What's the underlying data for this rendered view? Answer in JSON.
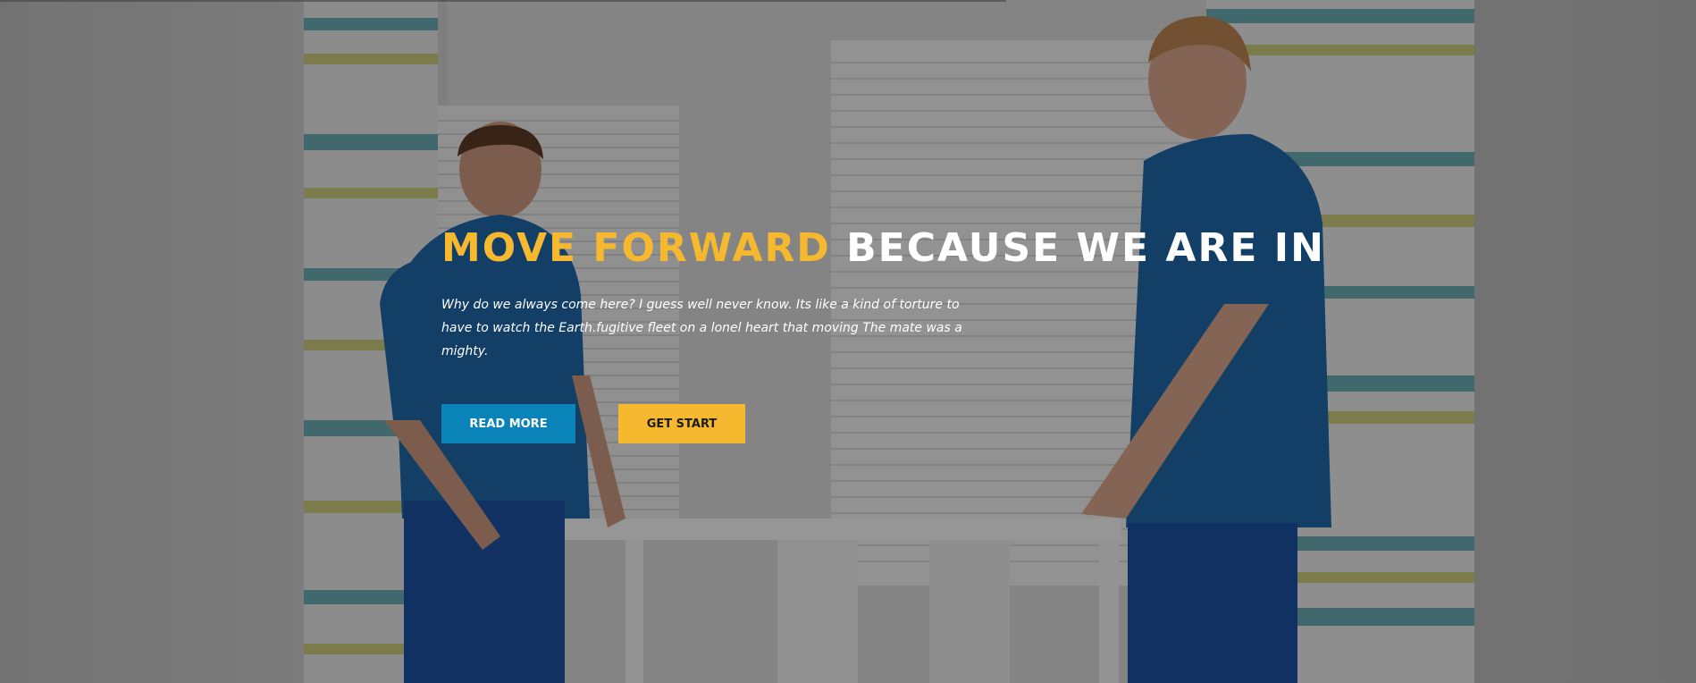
{
  "hero": {
    "headline_accent": "MOVE FORWARD",
    "headline_rest": "BECAUSE WE ARE IN",
    "subtext": "Why do we always come here? I guess well never know. Its like a kind of torture to have to watch the Earth.fugitive fleet on a lonel heart that moving The mate was a mighty.",
    "buttons": {
      "read_more": "READ MORE",
      "get_start": "GET START"
    },
    "colors": {
      "accent": "#f5b82e",
      "primary": "#0a84b8",
      "text": "#ffffff"
    }
  }
}
